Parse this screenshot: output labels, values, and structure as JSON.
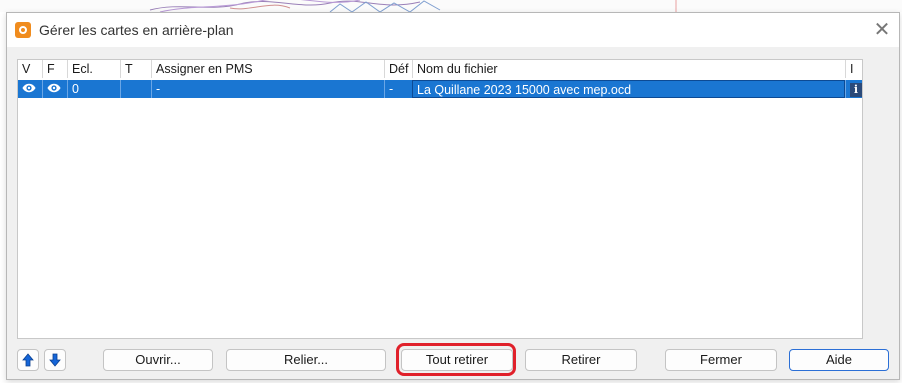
{
  "window": {
    "title": "Gérer les cartes en arrière-plan",
    "app_icon": "ocad-logo-icon",
    "close_glyph": "✕"
  },
  "table": {
    "columns": [
      "V",
      "F",
      "Ecl.",
      "T",
      "Assigner en PMS",
      "Déf",
      "Nom du fichier",
      "I"
    ],
    "rows": [
      {
        "visible_icon": "eye-icon",
        "f_icon": "eye-icon",
        "ecl": "0",
        "t": "",
        "pms": "-",
        "def": "-",
        "filename": "La Quillane 2023 15000 avec mep.ocd",
        "info_icon": "info-icon",
        "info_glyph": "i",
        "selected": true
      }
    ]
  },
  "buttons": {
    "move_up_icon": "arrow-up-icon",
    "move_down_icon": "arrow-down-icon",
    "open": "Ouvrir...",
    "link": "Relier...",
    "remove_all": "Tout retirer",
    "remove": "Retirer",
    "close": "Fermer",
    "help": "Aide"
  },
  "colors": {
    "selection": "#1a76d2",
    "app_icon": "#f08c1e",
    "highlight": "#e0202a",
    "arrow": "#1565d8",
    "primary_border": "#2b6fd6"
  }
}
